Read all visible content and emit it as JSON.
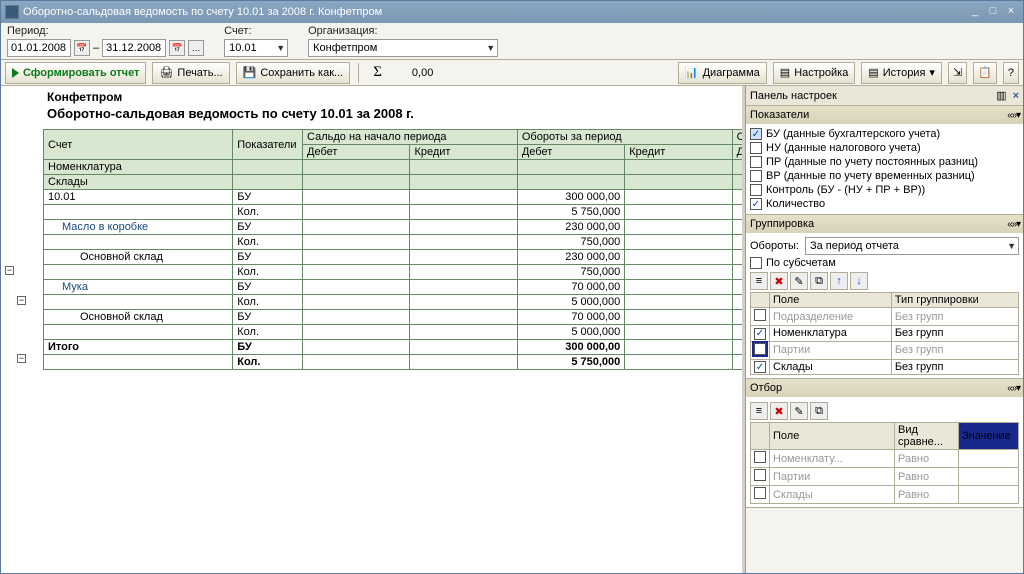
{
  "window": {
    "title": "Оборотно-сальдовая ведомость по счету 10.01 за 2008 г. Конфетпром"
  },
  "params": {
    "period_label": "Период:",
    "date_from": "01.01.2008",
    "date_to": "31.12.2008",
    "account_label": "Счет:",
    "account": "10.01",
    "org_label": "Организация:",
    "org": "Конфетпром"
  },
  "toolbar": {
    "run": "Сформировать отчет",
    "print": "Печать...",
    "save": "Сохранить как...",
    "sigma_value": "0,00",
    "diagram": "Диаграмма",
    "settings": "Настройка",
    "history": "История"
  },
  "report": {
    "org": "Конфетпром",
    "title": "Оборотно-сальдовая ведомость по счету 10.01 за 2008 г.",
    "headers": {
      "account": "Счет",
      "indicators": "Показатели",
      "start_balance": "Сальдо на начало периода",
      "turnover": "Обороты за период",
      "end_balance_short": "Сал",
      "debit": "Дебет",
      "credit": "Кредит",
      "deb_short": "Деб",
      "nomenclature": "Номенклатура",
      "warehouses": "Склады"
    },
    "rows": {
      "acct": "10.01",
      "bu": "БУ",
      "kol": "Кол.",
      "item1": "Масло в коробке",
      "item2": "Мука",
      "wh": "Основной склад",
      "total": "Итого",
      "v_acct_bu": "300 000,00",
      "v_acct_kol": "5 750,000",
      "v_i1_bu": "230 000,00",
      "v_i1_kol": "750,000",
      "v_i1w_bu": "230 000,00",
      "v_i1w_kol": "750,000",
      "v_i2_bu": "70 000,00",
      "v_i2_kol": "5 000,000",
      "v_i2w_bu": "70 000,00",
      "v_i2w_kol": "5 000,000",
      "v_tot_bu": "300 000,00",
      "v_tot_kol": "5 750,000"
    }
  },
  "sidepanel": {
    "title": "Панель настроек",
    "pokazateli": {
      "title": "Показатели",
      "bu": "БУ (данные бухгалтерского учета)",
      "nu": "НУ (данные налогового учета)",
      "pr": "ПР (данные по учету постоянных разниц)",
      "vr": "ВР (данные по учету временных разниц)",
      "ctrl": "Контроль (БУ - (НУ + ПР + ВР))",
      "kol": "Количество"
    },
    "group": {
      "title": "Группировка",
      "turnover_label": "Обороты:",
      "turnover_value": "За период отчета",
      "subacc": "По субсчетам",
      "col_field": "Поле",
      "col_type": "Тип группировки",
      "r1": "Подразделение",
      "r2": "Номенклатура",
      "r3": "Партии",
      "r4": "Склады",
      "gtype": "Без групп"
    },
    "filter": {
      "title": "Отбор",
      "col_field": "Поле",
      "col_cmp": "Вид сравне...",
      "col_val": "Значение",
      "r1": "Номенклату...",
      "r2": "Партии",
      "r3": "Склады",
      "eq": "Равно"
    }
  }
}
